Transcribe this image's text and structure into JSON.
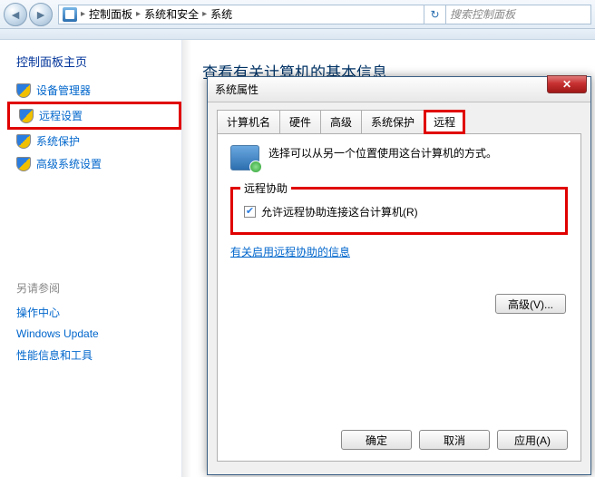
{
  "topbar": {
    "breadcrumb": [
      "控制面板",
      "系统和安全",
      "系统"
    ],
    "search_placeholder": "搜索控制面板"
  },
  "sidebar": {
    "title": "控制面板主页",
    "items": [
      {
        "label": "设备管理器",
        "icon": "shield"
      },
      {
        "label": "远程设置",
        "icon": "shield",
        "highlight": true
      },
      {
        "label": "系统保护",
        "icon": "shield"
      },
      {
        "label": "高级系统设置",
        "icon": "shield"
      }
    ],
    "see_also_title": "另请参阅",
    "see_also": [
      {
        "label": "操作中心"
      },
      {
        "label": "Windows Update"
      },
      {
        "label": "性能信息和工具"
      }
    ]
  },
  "content": {
    "heading": "查看有关计算机的基本信息"
  },
  "dialog": {
    "title": "系统属性",
    "tabs": [
      "计算机名",
      "硬件",
      "高级",
      "系统保护",
      "远程"
    ],
    "active_tab": 4,
    "remote": {
      "intro": "选择可以从另一个位置使用这台计算机的方式。",
      "group_legend": "远程协助",
      "checkbox_checked": true,
      "checkbox_label": "允许远程协助连接这台计算机(R)",
      "help_link": "有关启用远程协助的信息",
      "advanced_btn": "高级(V)..."
    },
    "buttons": {
      "ok": "确定",
      "cancel": "取消",
      "apply": "应用(A)"
    }
  }
}
